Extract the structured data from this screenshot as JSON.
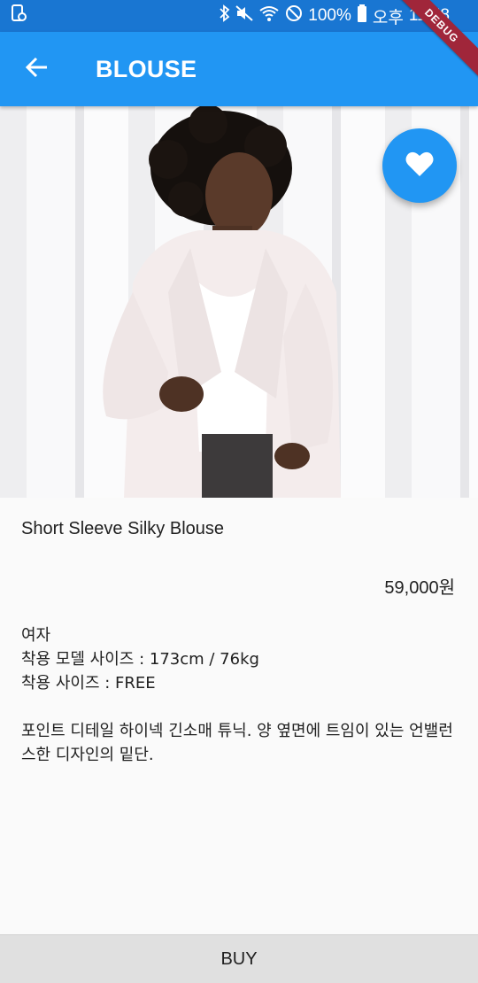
{
  "status_bar": {
    "battery": "100%",
    "ampm": "오후",
    "time": "11:58",
    "icons": [
      "screenshot-icon",
      "bluetooth-icon",
      "mute-icon",
      "wifi-icon",
      "do-not-disturb-icon",
      "battery-icon"
    ]
  },
  "debug_banner": "DEBUG",
  "app_bar": {
    "title": "BLOUSE",
    "back_icon": "arrow-back-icon",
    "color": "#2196f3"
  },
  "hero": {
    "favorite_icon": "heart-icon"
  },
  "product": {
    "name": "Short Sleeve Silky Blouse",
    "price": "59,000원",
    "info_lines": [
      "여자",
      "착용 모델 사이즈 : 173cm / 76kg",
      "착용 사이즈 : FREE"
    ],
    "description": "포인트 디테일 하이넥 긴소매 튜닉. 양 옆면에 트임이 있는 언밸런스한 디자인의 밑단."
  },
  "buy_button": {
    "label": "BUY"
  }
}
